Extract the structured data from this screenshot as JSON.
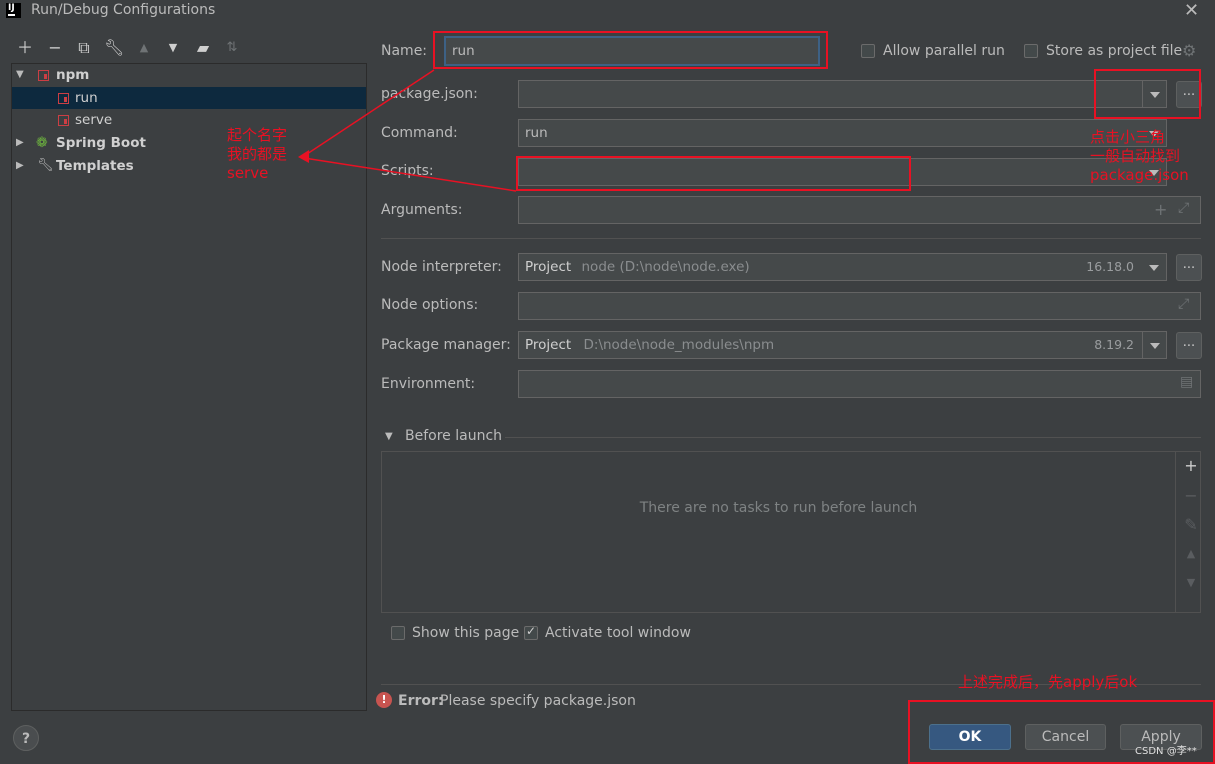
{
  "window": {
    "title": "Run/Debug Configurations",
    "logo_text": "IJ"
  },
  "toolbar": {
    "icons": [
      "add-icon",
      "remove-icon",
      "copy-icon",
      "wrench-icon",
      "move-up-icon",
      "move-down-icon",
      "new-folder-icon",
      "sort-icon"
    ]
  },
  "tree": {
    "npm": "npm",
    "run": "run",
    "serve": "serve",
    "spring_boot": "Spring Boot",
    "templates": "Templates"
  },
  "form": {
    "name_label": "Name:",
    "name_value": "run",
    "allow_parallel": "Allow parallel run",
    "store_as_project": "Store as project file",
    "package_json_label": "package.json:",
    "package_json_value": "",
    "command_label": "Command:",
    "command_value": "run",
    "scripts_label": "Scripts:",
    "scripts_value": "",
    "arguments_label": "Arguments:",
    "arguments_value": "",
    "node_interpreter_label": "Node interpreter:",
    "node_interpreter_prefix": "Project",
    "node_interpreter_path": "node (D:\\node\\node.exe)",
    "node_version": "16.18.0",
    "node_options_label": "Node options:",
    "package_manager_label": "Package manager:",
    "package_manager_prefix": "Project",
    "package_manager_path": "D:\\node\\node_modules\\npm",
    "package_manager_version": "8.19.2",
    "environment_label": "Environment:",
    "browse_label": "...",
    "before_launch": "Before launch",
    "no_tasks": "There are no tasks to run before launch",
    "show_page": "Show this page",
    "activate_tool": "Activate tool window"
  },
  "status": {
    "error_bold": "Error:",
    "error_text": "Please specify package.json"
  },
  "buttons": {
    "ok": "OK",
    "cancel": "Cancel",
    "apply": "Apply",
    "help": "?"
  },
  "annotations": {
    "name_note_1": "起个名字",
    "name_note_2": "我的都是",
    "name_note_3": "serve",
    "arrow_note_1": "点击小三角",
    "arrow_note_2": "一般自动找到",
    "arrow_note_3": "package.json",
    "bottom_note": "上述完成后，先apply后ok"
  },
  "watermark": "CSDN @李**"
}
